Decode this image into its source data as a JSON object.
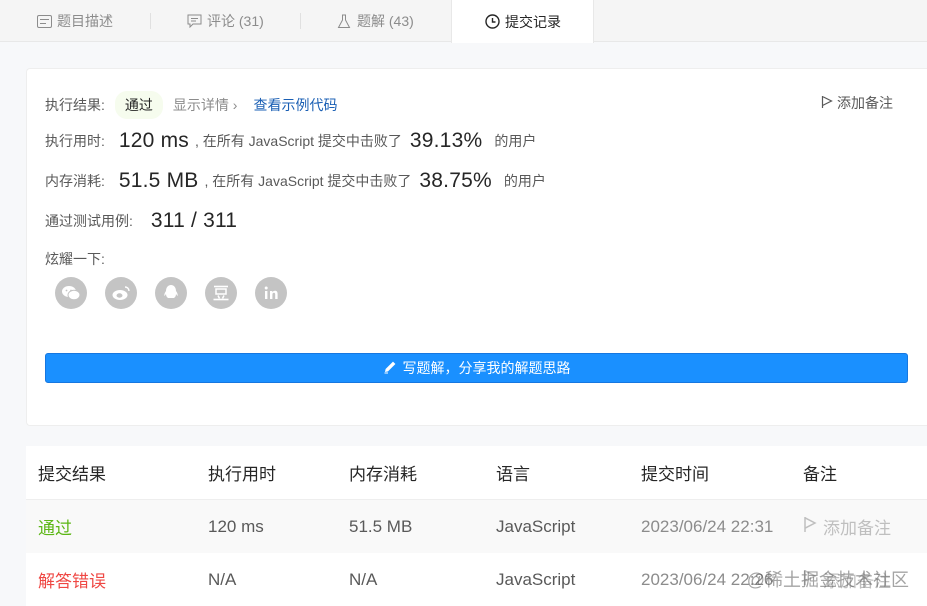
{
  "tabs": [
    {
      "label": "题目描述",
      "icon": "description-icon"
    },
    {
      "label": "评论 (31)",
      "icon": "comment-icon"
    },
    {
      "label": "题解 (43)",
      "icon": "flask-icon"
    },
    {
      "label": "提交记录",
      "icon": "clock-icon"
    }
  ],
  "result": {
    "label": "执行结果:",
    "status": "通过",
    "details_link": "显示详情",
    "sample_link": "查看示例代码",
    "add_note": "添加备注",
    "runtime_label": "执行用时:",
    "runtime_value": "120 ms",
    "runtime_text": ", 在所有 JavaScript 提交中击败了",
    "runtime_pct": "39.13%",
    "users_text": "的用户",
    "memory_label": "内存消耗:",
    "memory_value": "51.5 MB",
    "memory_text": ", 在所有 JavaScript 提交中击败了",
    "memory_pct": "38.75%",
    "tests_label": "通过测试用例:",
    "tests_value": "311 / 311",
    "share_label": "炫耀一下:",
    "write_button": "写题解，分享我的解题思路"
  },
  "table": {
    "headers": [
      "提交结果",
      "执行用时",
      "内存消耗",
      "语言",
      "提交时间",
      "备注"
    ],
    "rows": [
      {
        "result": "通过",
        "time": "120 ms",
        "memory": "51.5 MB",
        "lang": "JavaScript",
        "submitted": "2023/06/24 22:31",
        "note": "添加备注"
      },
      {
        "result": "解答错误",
        "time": "N/A",
        "memory": "N/A",
        "lang": "JavaScript",
        "submitted": "2023/06/24 22:26",
        "note": "添加备注"
      }
    ]
  },
  "watermark": "@稀土掘金技术社区",
  "colors": {
    "accent": "#1a90ff",
    "pass": "#5cb615",
    "error": "#ef4743"
  }
}
